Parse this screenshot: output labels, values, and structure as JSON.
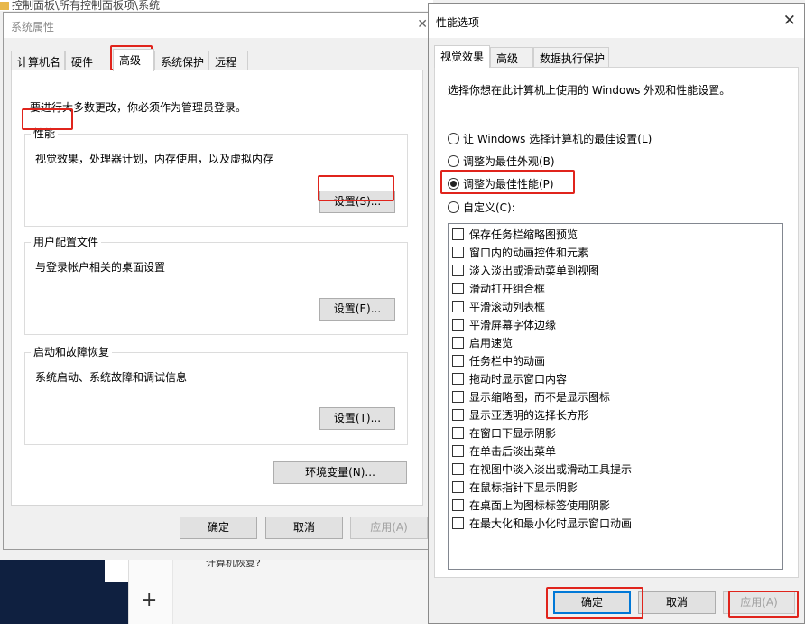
{
  "background": {
    "path_text": "控制面板\\所有控制面板项\\系统",
    "cut_text": "计算机恢复?",
    "plus": "+"
  },
  "system_props": {
    "title": "系统属性",
    "tabs": [
      "计算机名",
      "硬件",
      "高级",
      "系统保护",
      "远程"
    ],
    "admin_note": "要进行大多数更改，你必须作为管理员登录。",
    "groups": [
      {
        "legend": "性能",
        "desc": "视觉效果，处理器计划，内存使用，以及虚拟内存",
        "button": "设置(S)..."
      },
      {
        "legend": "用户配置文件",
        "desc": "与登录帐户相关的桌面设置",
        "button": "设置(E)..."
      },
      {
        "legend": "启动和故障恢复",
        "desc": "系统启动、系统故障和调试信息",
        "button": "设置(T)..."
      }
    ],
    "env_button": "环境变量(N)...",
    "ok": "确定",
    "cancel": "取消",
    "apply": "应用(A)"
  },
  "perf_options": {
    "title": "性能选项",
    "tabs": [
      "视觉效果",
      "高级",
      "数据执行保护"
    ],
    "intro": "选择你想在此计算机上使用的 Windows 外观和性能设置。",
    "radios": [
      {
        "label": "让 Windows 选择计算机的最佳设置(L)",
        "checked": false
      },
      {
        "label": "调整为最佳外观(B)",
        "checked": false
      },
      {
        "label": "调整为最佳性能(P)",
        "checked": true
      },
      {
        "label": "自定义(C):",
        "checked": false
      }
    ],
    "checkboxes": [
      "保存任务栏缩略图预览",
      "窗口内的动画控件和元素",
      "淡入淡出或滑动菜单到视图",
      "滑动打开组合框",
      "平滑滚动列表框",
      "平滑屏幕字体边缘",
      "启用速览",
      "任务栏中的动画",
      "拖动时显示窗口内容",
      "显示缩略图，而不是显示图标",
      "显示亚透明的选择长方形",
      "在窗口下显示阴影",
      "在单击后淡出菜单",
      "在视图中淡入淡出或滑动工具提示",
      "在鼠标指针下显示阴影",
      "在桌面上为图标标签使用阴影",
      "在最大化和最小化时显示窗口动画"
    ],
    "ok": "确定",
    "cancel": "取消",
    "apply": "应用(A)"
  },
  "colors": {
    "highlight": "#e0241c",
    "focus": "#0078d7"
  }
}
